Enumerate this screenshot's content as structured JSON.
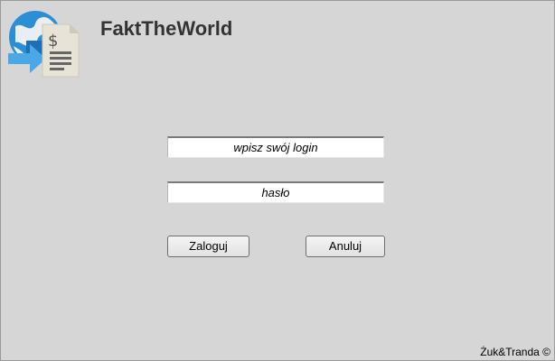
{
  "app": {
    "title": "FaktTheWorld",
    "logo_icon": "globe-invoice-logo-icon"
  },
  "login_form": {
    "login_placeholder": "wpisz swój login",
    "password_placeholder": "hasło",
    "login_button": "Zaloguj",
    "cancel_button": "Anuluj"
  },
  "footer": {
    "copyright": "Żuk&Tranda ©"
  },
  "colors": {
    "background": "#d6d6d6",
    "title_text": "#333333",
    "logo_globe": "#2a8fd4",
    "logo_arrow": "#4aa8e6",
    "logo_document": "#e7e3d6"
  }
}
